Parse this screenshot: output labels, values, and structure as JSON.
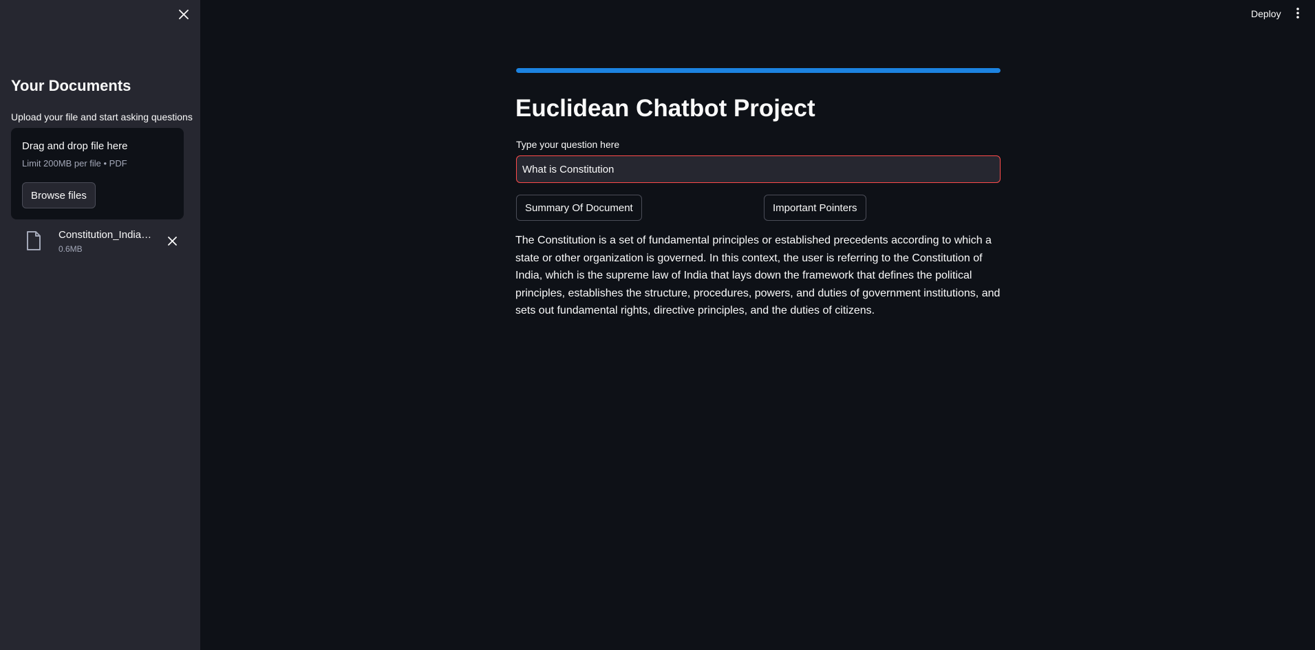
{
  "sidebar": {
    "title": "Your Documents",
    "uploader_label": "Upload your file and start asking questions",
    "dropzone": {
      "title": "Drag and drop file here",
      "limit": "Limit 200MB per file • PDF",
      "browse_label": "Browse files"
    },
    "file": {
      "name": "Constitution_India…",
      "size": "0.6MB"
    }
  },
  "header": {
    "deploy_label": "Deploy"
  },
  "main": {
    "progress_percent": 100,
    "title": "Euclidean Chatbot Project",
    "question_label": "Type your question here",
    "question_value": "What is Constitution ",
    "buttons": {
      "summary": "Summary Of Document",
      "pointers": "Important Pointers"
    },
    "answer": "The Constitution is a set of fundamental principles or established precedents according to which a state or other organization is governed. In this context, the user is referring to the Constitution of India, which is the supreme law of India that lays down the framework that defines the political principles, establishes the structure, procedures, powers, and duties of government institutions, and sets out fundamental rights, directive principles, and the duties of citizens."
  },
  "icons": {
    "sidebar_close": "close-icon",
    "file": "file-icon",
    "file_remove": "close-icon",
    "menu": "vertical-dots-icon"
  },
  "colors": {
    "background": "#0e1117",
    "sidebar": "#262730",
    "accent": "#1c83e1",
    "input_border_focus": "#ff4b4b",
    "text": "#fafafa",
    "muted_text": "#a3a8b8"
  }
}
